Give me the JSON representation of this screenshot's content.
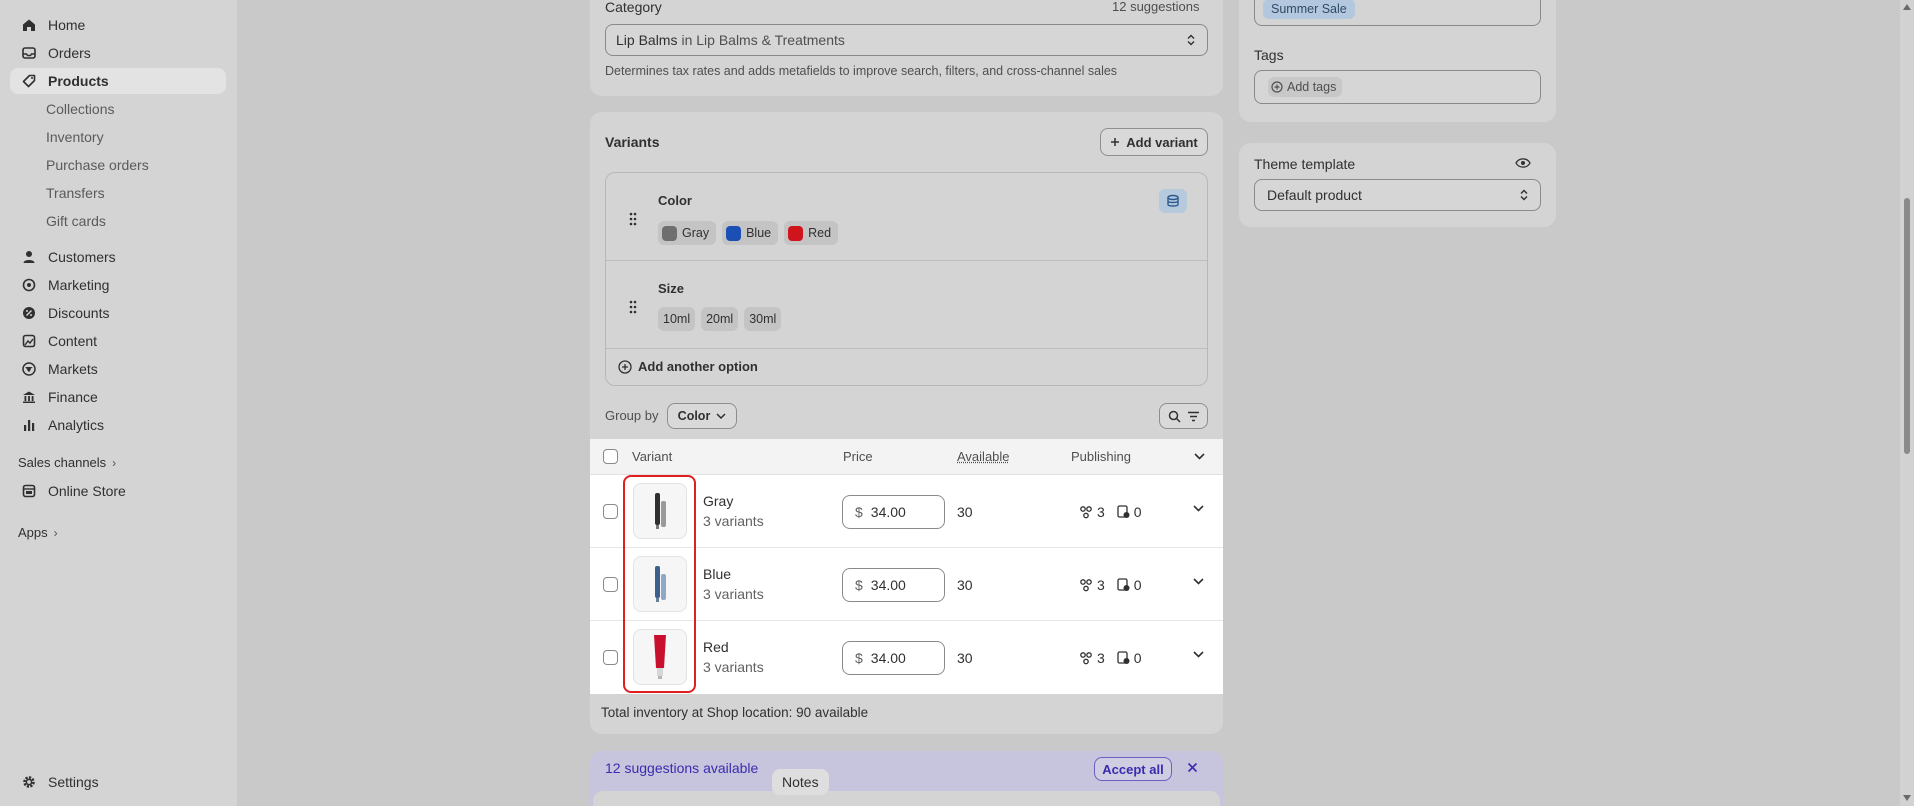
{
  "sidebar": {
    "home": "Home",
    "orders": "Orders",
    "products": "Products",
    "sub": [
      "Collections",
      "Inventory",
      "Purchase orders",
      "Transfers",
      "Gift cards"
    ],
    "customers": "Customers",
    "marketing": "Marketing",
    "discounts": "Discounts",
    "content": "Content",
    "markets": "Markets",
    "finance": "Finance",
    "analytics": "Analytics",
    "sales_channels": "Sales channels",
    "online_store": "Online Store",
    "apps": "Apps",
    "settings": "Settings"
  },
  "category": {
    "label": "Category",
    "suggestions": "12 suggestions",
    "value_bold": "Lip Balms",
    "value_rest": "in Lip Balms & Treatments",
    "help": "Determines tax rates and adds metafields to improve search, filters, and cross-channel sales"
  },
  "variants": {
    "title": "Variants",
    "add_variant": "Add variant",
    "options": [
      {
        "name": "Color",
        "values": [
          "Gray",
          "Blue",
          "Red"
        ],
        "swatches": [
          "#6f6f6f",
          "#1c4fb5",
          "#d0141b"
        ]
      },
      {
        "name": "Size",
        "values": [
          "10ml",
          "20ml",
          "30ml"
        ]
      }
    ],
    "add_option": "Add another option",
    "group_by_label": "Group by",
    "group_by_value": "Color",
    "table": {
      "headers": {
        "variant": "Variant",
        "price": "Price",
        "available": "Available",
        "publishing": "Publishing"
      },
      "rows": [
        {
          "name": "Gray",
          "sub": "3 variants",
          "currency": "$",
          "price": "34.00",
          "available": "30",
          "channels": "3",
          "markets": "0"
        },
        {
          "name": "Blue",
          "sub": "3 variants",
          "currency": "$",
          "price": "34.00",
          "available": "30",
          "channels": "3",
          "markets": "0"
        },
        {
          "name": "Red",
          "sub": "3 variants",
          "currency": "$",
          "price": "34.00",
          "available": "30",
          "channels": "3",
          "markets": "0"
        }
      ]
    },
    "total": "Total inventory at Shop location: 90 available"
  },
  "suggestions_bar": {
    "text": "12 suggestions available",
    "accept_all": "Accept all"
  },
  "notes_tooltip": "Notes",
  "right": {
    "collection_chip": "Summer Sale",
    "tags_label": "Tags",
    "add_tags": "Add tags",
    "theme_label": "Theme template",
    "theme_value": "Default product"
  },
  "colors": {
    "highlight": "#e02020",
    "link": "#3a2bb0"
  }
}
